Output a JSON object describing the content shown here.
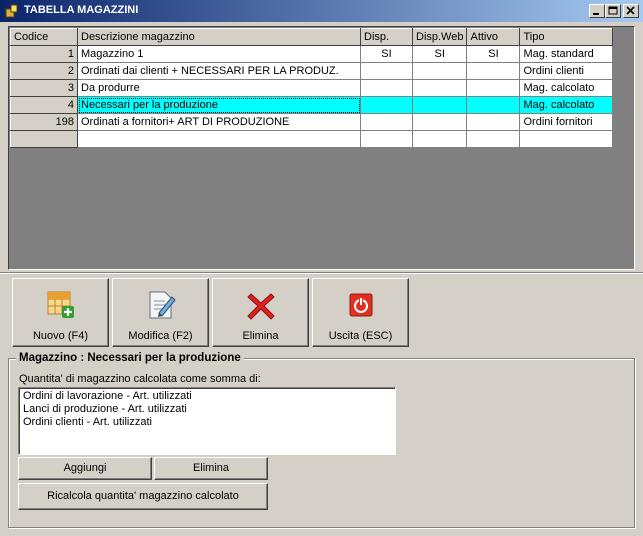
{
  "window": {
    "title": "TABELLA MAGAZZINI"
  },
  "grid": {
    "columns": [
      "Codice",
      "Descrizione magazzino",
      "Disp.",
      "Disp.Web",
      "Attivo",
      "Tipo"
    ],
    "rows": [
      {
        "codice": "1",
        "descrizione": "Magazzino 1",
        "disp": "SI",
        "disp_web": "SI",
        "attivo": "SI",
        "tipo": "Mag. standard"
      },
      {
        "codice": "2",
        "descrizione": "Ordinati dai clienti + NECESSARI  PER LA PRODUZ.",
        "disp": "",
        "disp_web": "",
        "attivo": "",
        "tipo": "Ordini clienti"
      },
      {
        "codice": "3",
        "descrizione": "Da produrre",
        "disp": "",
        "disp_web": "",
        "attivo": "",
        "tipo": "Mag. calcolato"
      },
      {
        "codice": "4",
        "descrizione": "Necessari per la produzione",
        "disp": "",
        "disp_web": "",
        "attivo": "",
        "tipo": "Mag. calcolato"
      },
      {
        "codice": "198",
        "descrizione": "Ordinati a fornitori+ ART DI PRODUZIONE",
        "disp": "",
        "disp_web": "",
        "attivo": "",
        "tipo": "Ordini fornitori"
      },
      {
        "codice": "",
        "descrizione": "",
        "disp": "",
        "disp_web": "",
        "attivo": "",
        "tipo": ""
      }
    ],
    "selected_row": 3,
    "selection_color": "#00ffff"
  },
  "toolbar": {
    "buttons": [
      {
        "label": "Nuovo (F4)",
        "icon": "grid-add-icon"
      },
      {
        "label": "Modifica (F2)",
        "icon": "document-edit-icon"
      },
      {
        "label": "Elimina",
        "icon": "red-x-icon"
      },
      {
        "label": "Uscita (ESC)",
        "icon": "power-exit-icon"
      }
    ]
  },
  "detail": {
    "group_title": "Magazzino : Necessari per la produzione",
    "description": "Quantita' di magazzino calcolata come somma di:",
    "list_items": [
      "Ordini di lavorazione - Art. utilizzati",
      "Lanci di produzione - Art. utilizzati",
      "Ordini clienti - Art. utilizzati"
    ],
    "add_label": "Aggiungi",
    "delete_label": "Elimina",
    "recalc_label": "Ricalcola quantita' magazzino calcolato"
  }
}
